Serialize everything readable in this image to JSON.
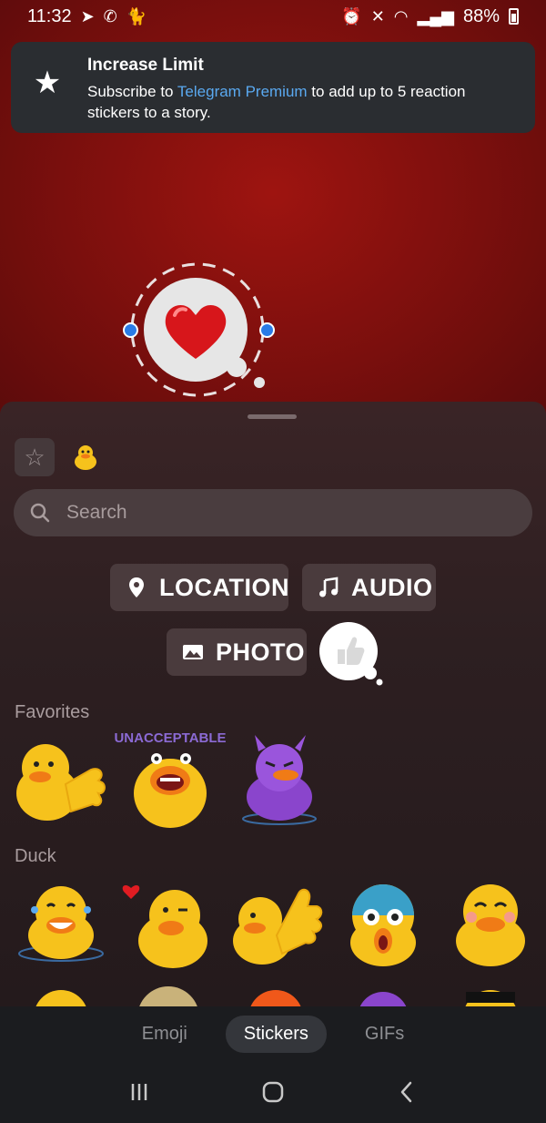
{
  "status_bar": {
    "time": "11:32",
    "battery": "88%"
  },
  "toast": {
    "title": "Increase Limit",
    "body_prefix": "Subscribe to ",
    "link": "Telegram Premium",
    "body_suffix": " to add up to 5 reaction stickers to a story.",
    "icon": "star-icon"
  },
  "sheet": {
    "search": {
      "placeholder": "Search"
    },
    "widgets": {
      "location": "LOCATION",
      "audio": "AUDIO",
      "photo": "PHOTO"
    },
    "sections": {
      "favorites": "Favorites",
      "duck": "Duck"
    },
    "favorites_text": "UNACCEPTABLE"
  },
  "tabs": {
    "emoji": "Emoji",
    "stickers": "Stickers",
    "gifs": "GIFs"
  },
  "colors": {
    "accent_link": "#5aa9f0",
    "backdrop": "#8b1210",
    "duck_yellow": "#f6c21c",
    "handle_blue": "#2a7be6"
  }
}
